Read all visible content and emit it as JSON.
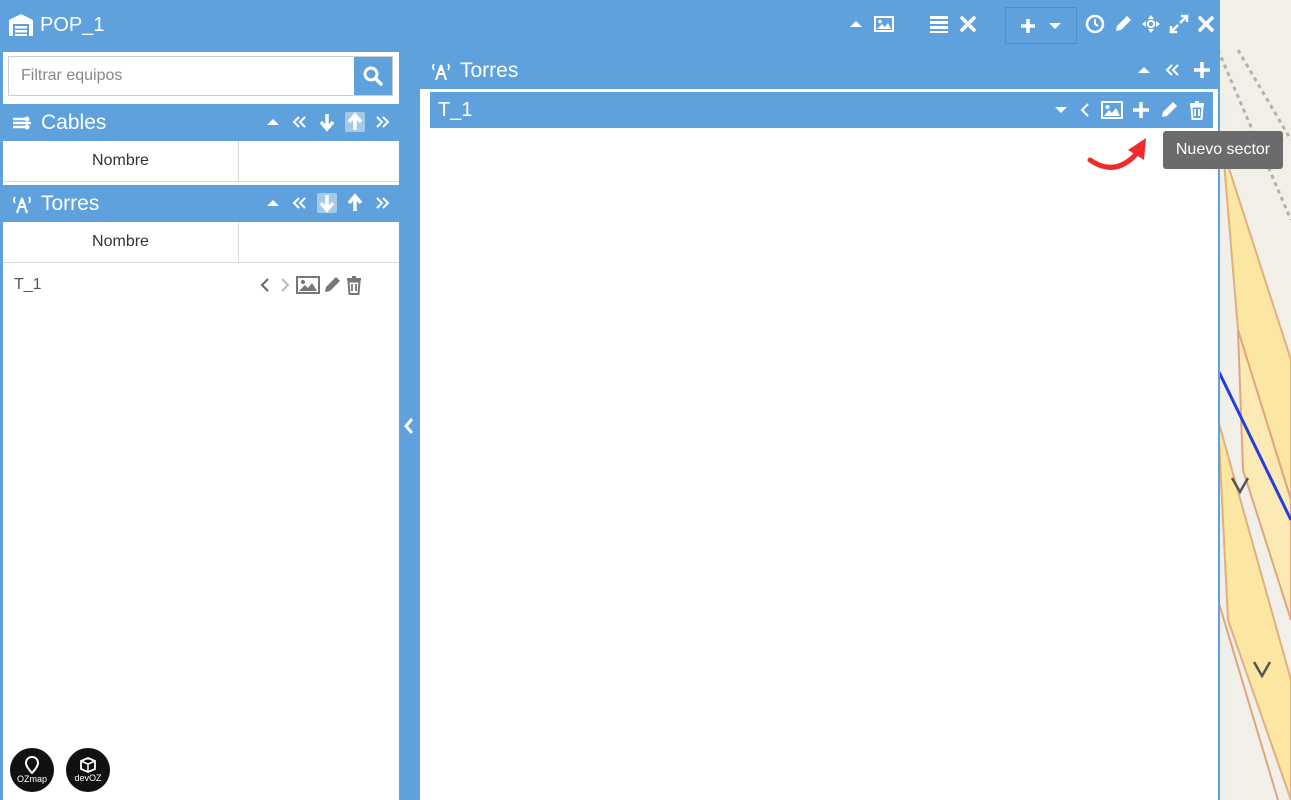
{
  "window": {
    "title": "POP_1"
  },
  "search": {
    "placeholder": "Filtrar equipos"
  },
  "cables": {
    "title": "Cables",
    "columns": [
      "Nombre",
      ""
    ]
  },
  "torres_left": {
    "title": "Torres",
    "columns": [
      "Nombre",
      ""
    ],
    "rows": [
      {
        "name": "T_1"
      }
    ]
  },
  "torres_right": {
    "title": "Torres",
    "item": {
      "name": "T_1"
    }
  },
  "tooltip": {
    "text": "Nuevo sector"
  },
  "logos": {
    "ozmap": "OZmap",
    "devoz": "devOZ"
  },
  "colors": {
    "primary": "#5fa1dc",
    "tooltip": "#6b6b6b",
    "annotation_arrow": "#ee2a2a"
  },
  "icons": {
    "window": [
      "warehouse-icon",
      "caret-up-icon",
      "image-icon",
      "list-icon",
      "close-icon",
      "plus-icon",
      "caret-down-icon",
      "clock-icon",
      "pencil-icon",
      "move-icon",
      "expand-icon",
      "close-icon"
    ]
  }
}
